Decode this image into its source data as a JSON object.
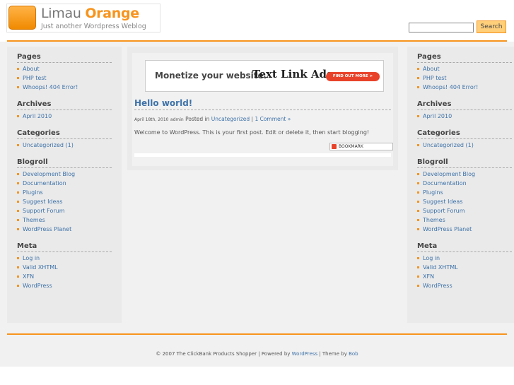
{
  "header": {
    "title_plain": "Limau ",
    "title_accent": "Orange",
    "tagline": "Just another Wordpress Weblog",
    "search": {
      "value": "",
      "button_label": "Search"
    }
  },
  "banner": {
    "left_text": "Monetize your website.",
    "brand_text": "Text Link Ads",
    "button_label": "FIND OUT MORE >"
  },
  "post": {
    "title": "Hello world!",
    "date": "April 18th, 2010",
    "author": "admin",
    "posted_in_label": "Posted in",
    "category": "Uncategorized",
    "separator": "|",
    "comments": "1 Comment »",
    "body": "Welcome to WordPress. This is your first post. Edit or delete it, then start blogging!",
    "bookmark_label": "BOOKMARK"
  },
  "sidebar": {
    "pages_title": "Pages",
    "pages": [
      "About",
      "PHP test",
      "Whoops! 404 Error!"
    ],
    "archives_title": "Archives",
    "archives": [
      "April 2010"
    ],
    "categories_title": "Categories",
    "categories": [
      "Uncategorized (1)"
    ],
    "blogroll_title": "Blogroll",
    "blogroll": [
      "Development Blog",
      "Documentation",
      "Plugins",
      "Suggest Ideas",
      "Support Forum",
      "Themes",
      "WordPress Planet"
    ],
    "meta_title": "Meta",
    "meta": [
      "Log in",
      "Valid XHTML",
      "XFN",
      "WordPress"
    ]
  },
  "footer": {
    "copyright": "© 2007 The ClickBank Products Shopper | Powered by ",
    "wp_link": "WordPress",
    "theme_text": " | Theme by ",
    "theme_author": "Bob"
  },
  "colors": {
    "accent": "#f7941d",
    "link": "#3e72a8",
    "background": "#f1f1f1"
  }
}
